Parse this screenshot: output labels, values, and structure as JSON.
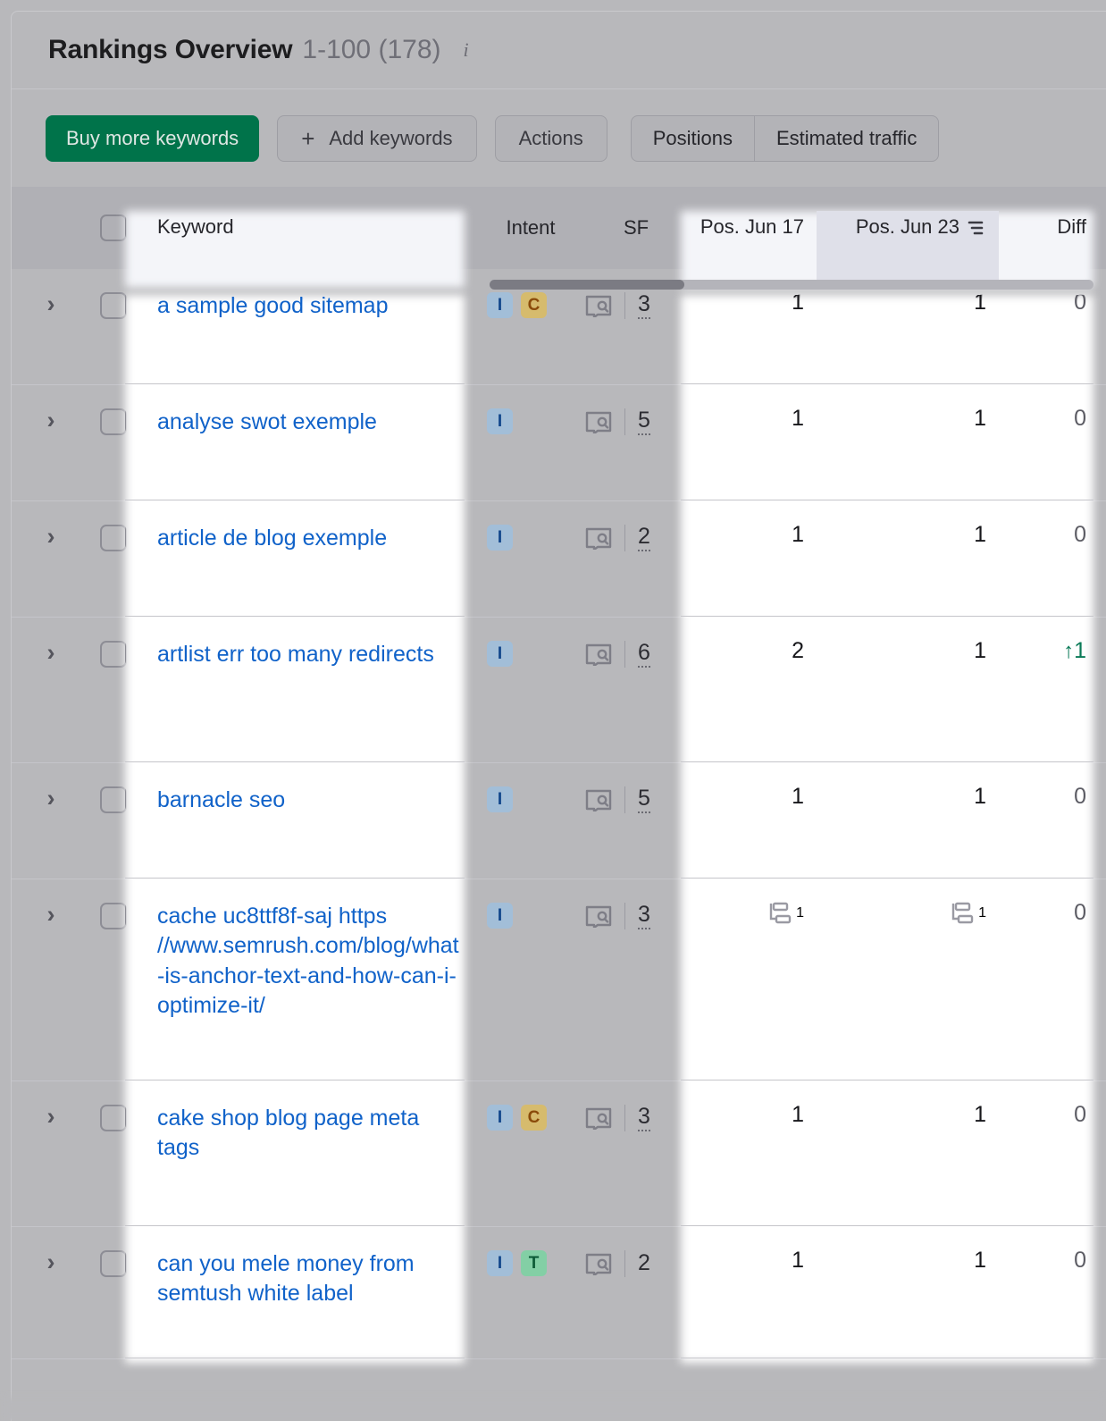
{
  "header": {
    "title": "Rankings Overview",
    "range": "1-100 (178)",
    "info_icon": "info-icon"
  },
  "toolbar": {
    "buy_label": "Buy more keywords",
    "add_label": "Add keywords",
    "add_plus": "+",
    "actions_label": "Actions",
    "segmented": [
      "Positions",
      "Estimated traffic"
    ],
    "accent_color": "#00734a"
  },
  "table": {
    "columns": {
      "keyword": "Keyword",
      "intent": "Intent",
      "sf": "SF",
      "pos_prev": "Pos. Jun 17",
      "pos_curr": "Pos. Jun 23",
      "diff": "Diff"
    },
    "sorted_column": "pos_curr",
    "sort_icon": "sort-descending-icon",
    "chevron_glyph": "›",
    "rows": [
      {
        "keyword": "a sample good sitemap",
        "intents": [
          "I",
          "C"
        ],
        "serp_feature_icon": "serp-feature-icon",
        "sf": "3",
        "sf_dotted": true,
        "pos_prev": "1",
        "pos_curr": "1",
        "pos_prev_icon": null,
        "pos_curr_icon": null,
        "diff": "0",
        "diff_dir": "none"
      },
      {
        "keyword": "analyse swot exemple",
        "intents": [
          "I"
        ],
        "serp_feature_icon": "serp-feature-icon",
        "sf": "5",
        "sf_dotted": true,
        "pos_prev": "1",
        "pos_curr": "1",
        "pos_prev_icon": null,
        "pos_curr_icon": null,
        "diff": "0",
        "diff_dir": "none"
      },
      {
        "keyword": "article de blog exemple",
        "intents": [
          "I"
        ],
        "serp_feature_icon": "serp-feature-icon",
        "sf": "2",
        "sf_dotted": true,
        "pos_prev": "1",
        "pos_curr": "1",
        "pos_prev_icon": null,
        "pos_curr_icon": null,
        "diff": "0",
        "diff_dir": "none"
      },
      {
        "keyword": "artlist err too many redirects",
        "intents": [
          "I"
        ],
        "serp_feature_icon": "serp-feature-icon",
        "sf": "6",
        "sf_dotted": true,
        "pos_prev": "2",
        "pos_curr": "1",
        "pos_prev_icon": null,
        "pos_curr_icon": null,
        "diff": "1",
        "diff_dir": "up",
        "diff_arrow": "↑"
      },
      {
        "keyword": "barnacle seo",
        "intents": [
          "I"
        ],
        "serp_feature_icon": "serp-feature-icon",
        "sf": "5",
        "sf_dotted": true,
        "pos_prev": "1",
        "pos_curr": "1",
        "pos_prev_icon": null,
        "pos_curr_icon": null,
        "diff": "0",
        "diff_dir": "none"
      },
      {
        "keyword": "cache uc8ttf8f-saj https //www.semrush.com/blog/what-is-anchor-text-and-how-can-i-optimize-it/",
        "intents": [
          "I"
        ],
        "serp_feature_icon": "serp-feature-icon",
        "sf": "3",
        "sf_dotted": true,
        "pos_prev": "1",
        "pos_curr": "1",
        "pos_prev_icon": "sitelinks-icon",
        "pos_curr_icon": "sitelinks-icon",
        "diff": "0",
        "diff_dir": "none"
      },
      {
        "keyword": "cake shop blog page meta tags",
        "intents": [
          "I",
          "C"
        ],
        "serp_feature_icon": "serp-feature-icon",
        "sf": "3",
        "sf_dotted": true,
        "pos_prev": "1",
        "pos_curr": "1",
        "pos_prev_icon": null,
        "pos_curr_icon": null,
        "diff": "0",
        "diff_dir": "none"
      },
      {
        "keyword": "can you mele money from semtush white label",
        "intents": [
          "I",
          "T"
        ],
        "serp_feature_icon": "serp-feature-icon",
        "sf": "2",
        "sf_dotted": false,
        "pos_prev": "1",
        "pos_curr": "1",
        "pos_prev_icon": null,
        "pos_curr_icon": null,
        "diff": "0",
        "diff_dir": "none"
      }
    ]
  },
  "intent_colors": {
    "I": "#a2bed8",
    "C": "#d6bb6d",
    "T": "#83cfa5"
  }
}
